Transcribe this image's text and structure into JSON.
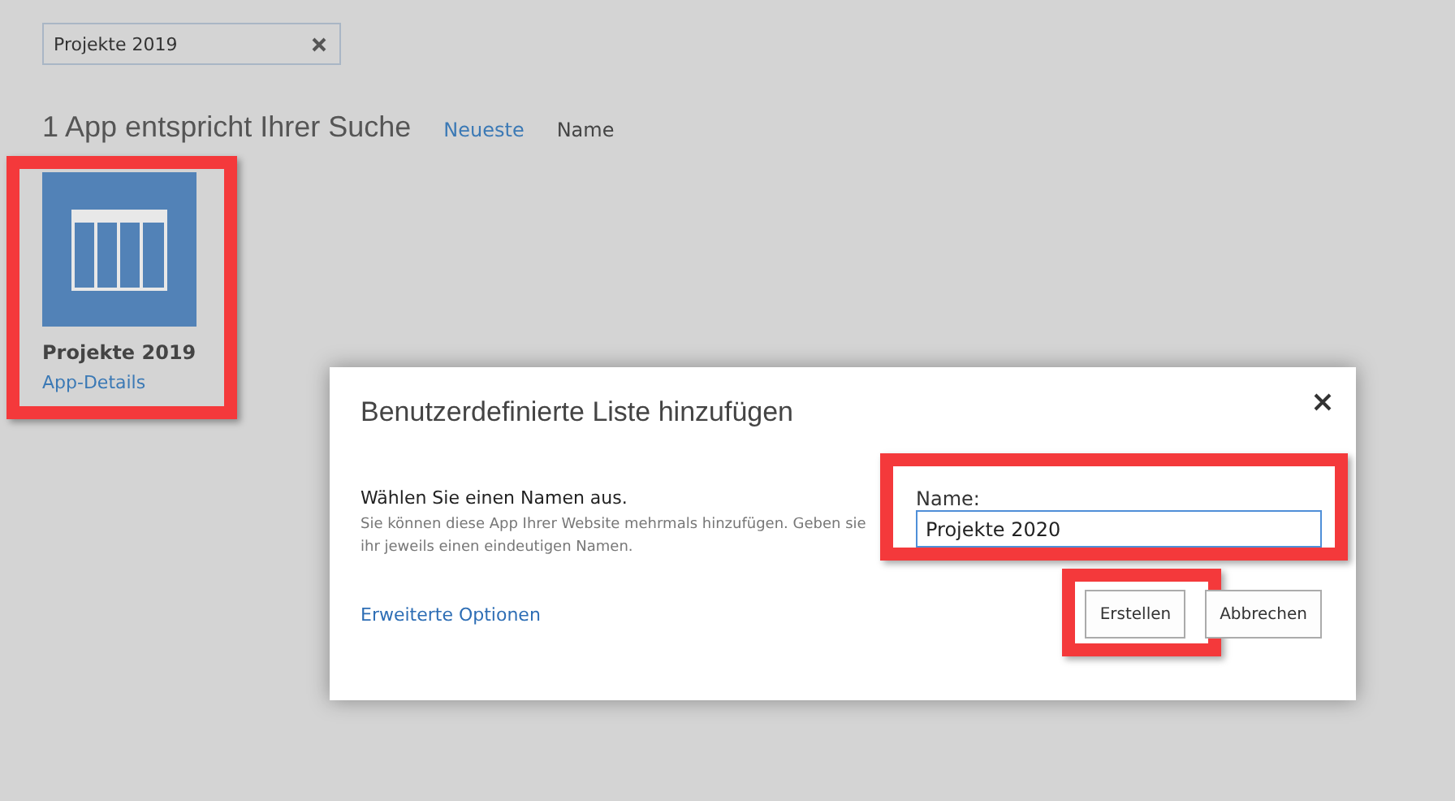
{
  "search": {
    "value": "Projekte 2019"
  },
  "results": {
    "heading": "1 App entspricht Ihrer Suche",
    "sort_options": [
      {
        "label": "Neueste",
        "selected": false
      },
      {
        "label": "Name",
        "selected": true
      }
    ]
  },
  "apps": [
    {
      "title": "Projekte 2019",
      "link": "App-Details",
      "highlighted": true
    }
  ],
  "dialog": {
    "title": "Benutzerdefinierte Liste hinzufügen",
    "section_title": "Wählen Sie einen Namen aus.",
    "section_text": "Sie können diese App Ihrer Website mehrmals hinzufügen. Geben sie ihr jeweils einen eindeutigen Namen.",
    "advanced_link": "Erweiterte Optionen",
    "name_label": "Name:",
    "name_value": "Projekte 2020",
    "name_highlighted": true,
    "buttons": [
      {
        "label": "Erstellen",
        "highlighted": true
      },
      {
        "label": "Abbrechen",
        "highlighted": false
      }
    ]
  }
}
